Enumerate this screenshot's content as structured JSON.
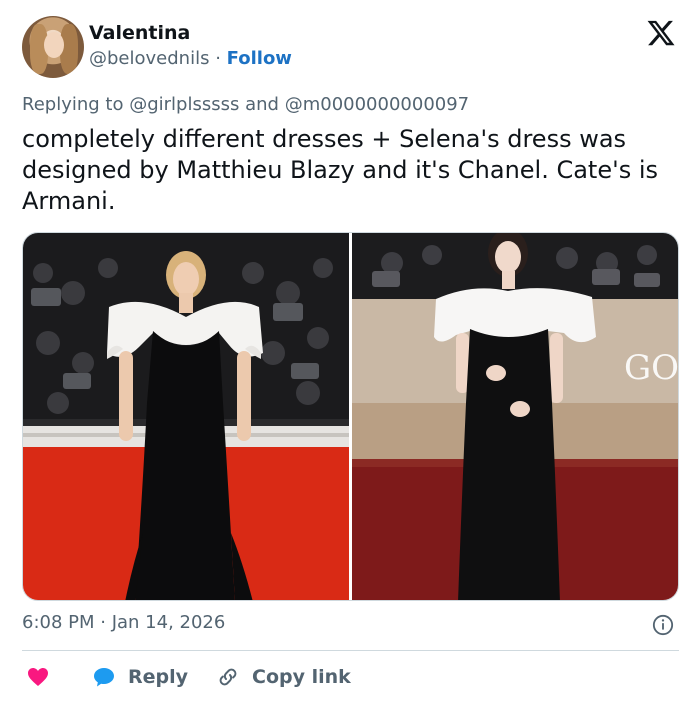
{
  "author": {
    "name": "Valentina",
    "handle": "@belovednils",
    "separator": "·",
    "follow_label": "Follow"
  },
  "reply_context": {
    "prefix": "Replying to",
    "mention_1": "@girlplsssss",
    "conjunction": "and",
    "mention_2": "@m0000000000097"
  },
  "tweet": {
    "text": "completely different dresses + Selena's dress was designed by Matthieu Blazy and it's Chanel. Cate's is Armani."
  },
  "media": {
    "right_photo_backdrop_text": "GOLD"
  },
  "meta": {
    "timestamp": "6:08 PM · Jan 14, 2026"
  },
  "actions": {
    "reply_label": "Reply",
    "copy_label": "Copy link"
  },
  "colors": {
    "like": "#f91880",
    "reply": "#1d9bf0",
    "follow": "#1d72c4",
    "secondary_text": "#536471"
  },
  "icons": {
    "brand": "x-logo-icon",
    "info": "info-icon",
    "like": "heart-icon",
    "reply": "speech-bubble-icon",
    "copy": "link-icon"
  }
}
